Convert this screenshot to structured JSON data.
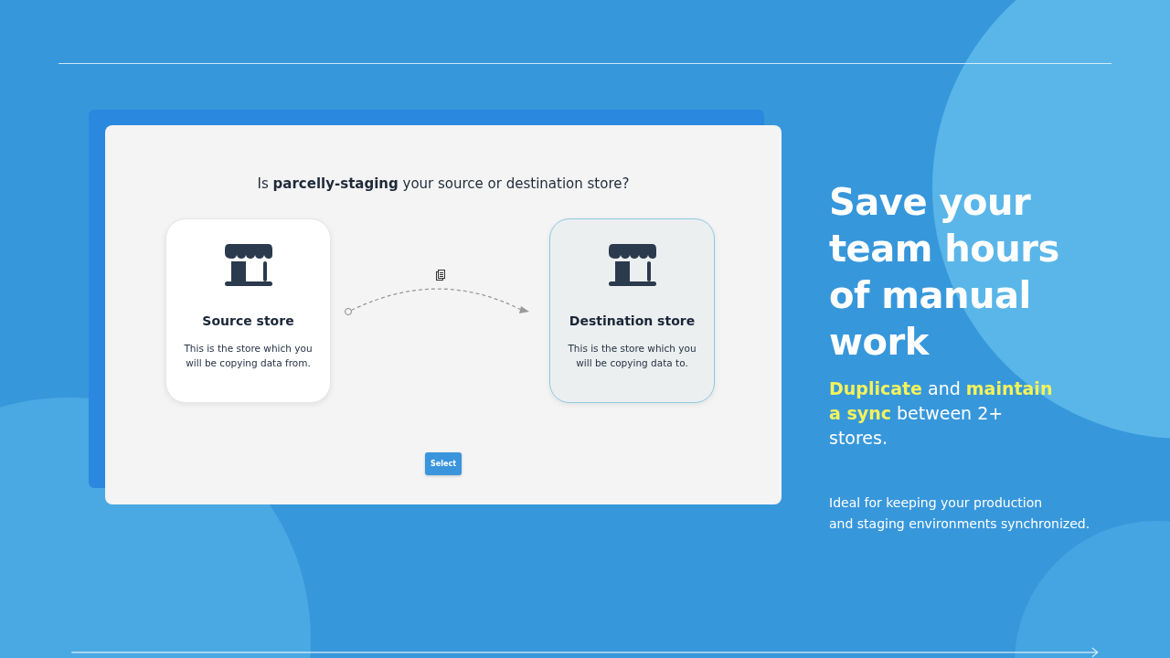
{
  "dialog": {
    "question": "Is **parcelly-staging** your source or destination store?",
    "stores": [
      {
        "title": "Source store",
        "description": "This is the store which you will be copying data from.",
        "selected": false
      },
      {
        "title": "Destination store",
        "description": "This is the store which you will be copying data to.",
        "selected": true
      }
    ],
    "button": "Select"
  },
  "headline": "Save your team hours of manual work",
  "subheadline": "**Duplicate** and **maintain a sync** between 2+ stores.",
  "note": "Ideal for keeping your production\nand staging environments synchronized."
}
